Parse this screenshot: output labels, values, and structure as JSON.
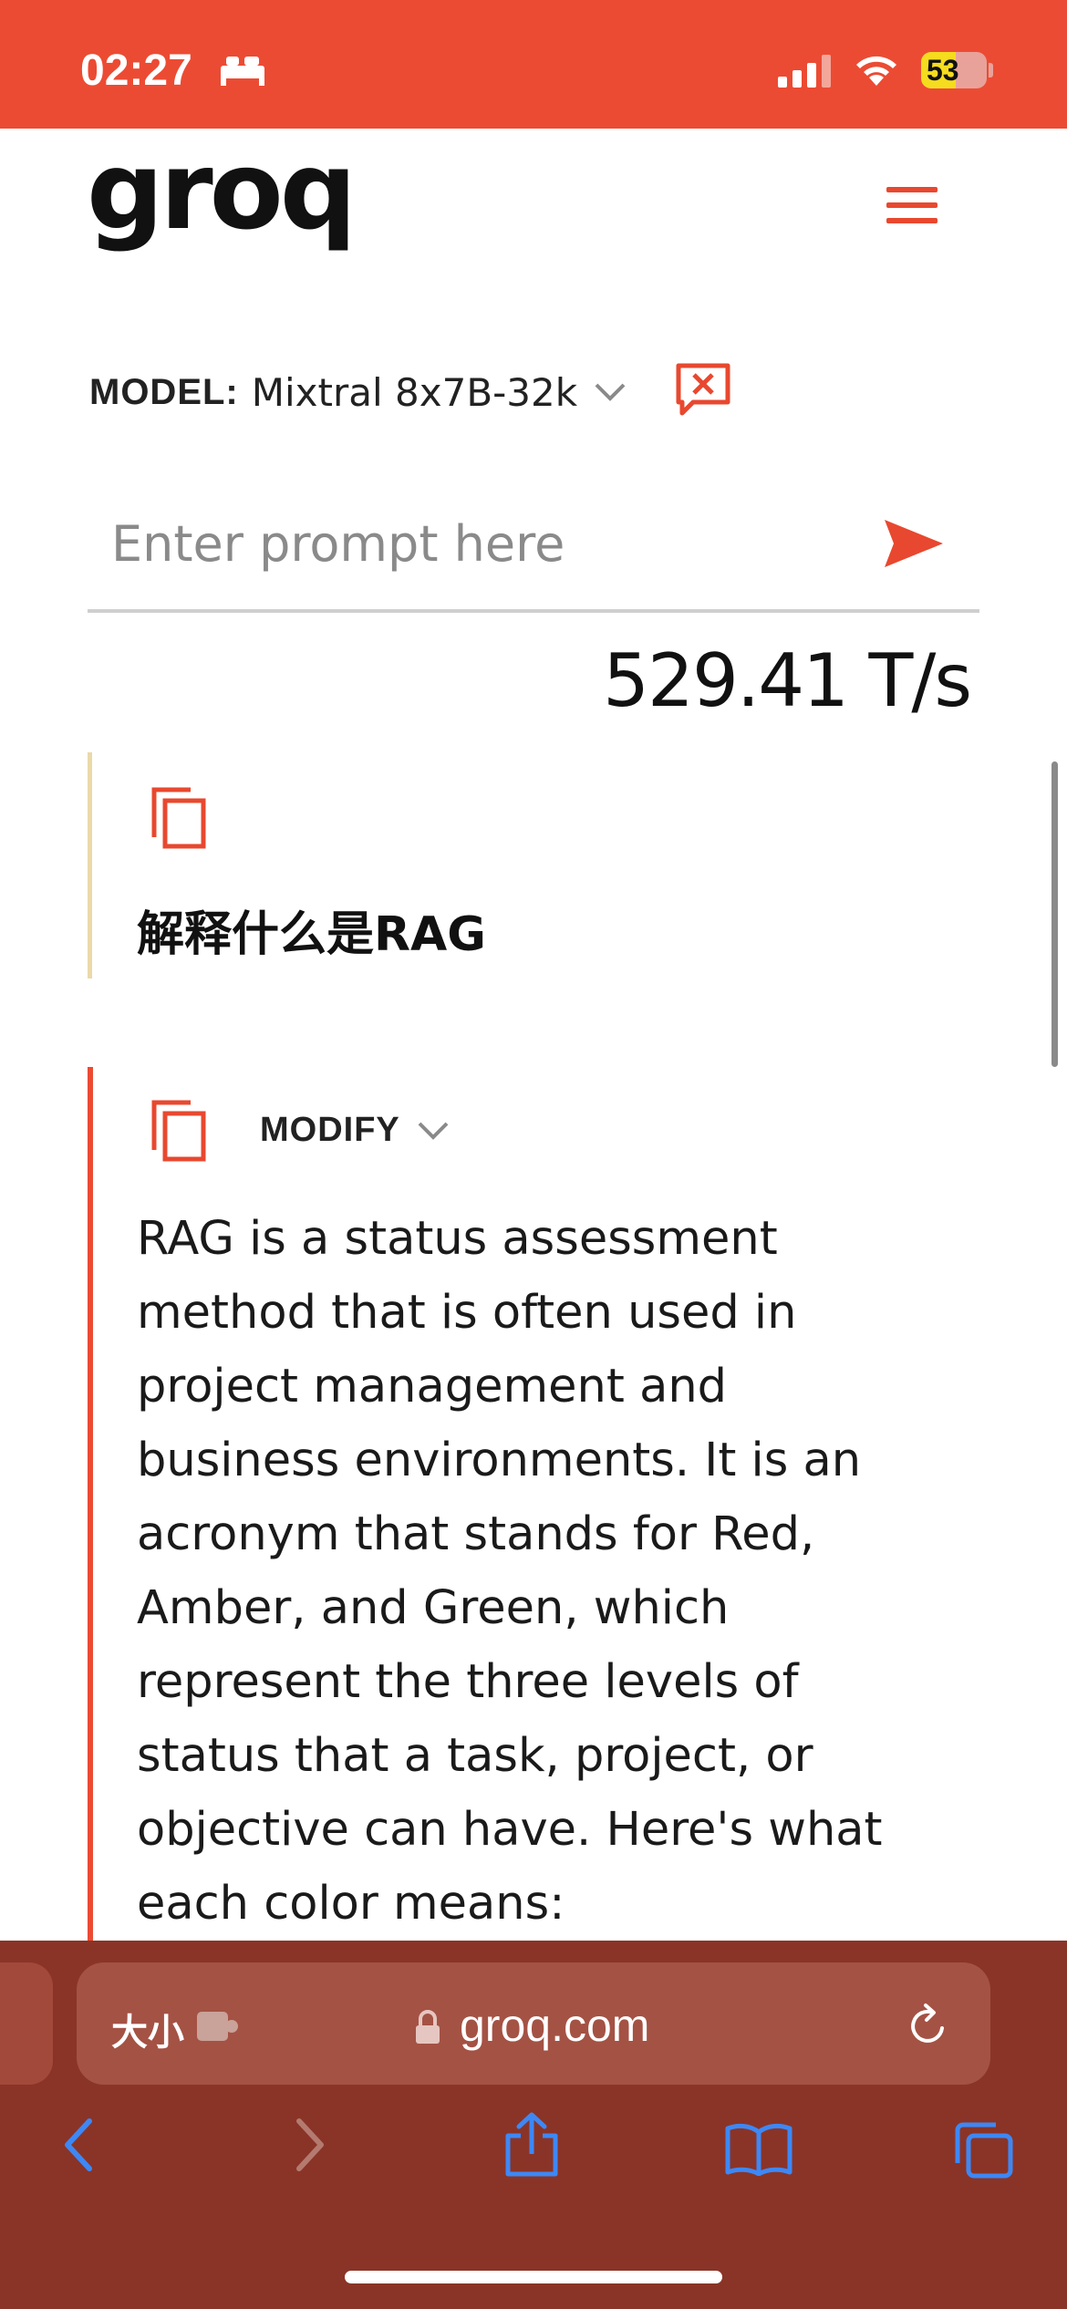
{
  "status_bar": {
    "time": "02:27",
    "battery_level": "53",
    "battery_fraction": 0.53,
    "colors": {
      "background": "#ec4b33"
    }
  },
  "header": {
    "logo": "groq",
    "menu_icon": "hamburger-icon"
  },
  "model_selector": {
    "label": "MODEL:",
    "value": "Mixtral 8x7B-32k"
  },
  "prompt": {
    "placeholder": "Enter prompt here"
  },
  "speed": "529.41 T/s",
  "messages": {
    "user": {
      "text": "解释什么是RAG",
      "accent": "#ead9a8"
    },
    "assistant": {
      "modify_label": "MODIFY",
      "accent": "#ec4b33",
      "text": "RAG is a status assessment\nmethod that is often used in\nproject management and\nbusiness environments. It is an\nacronym that stands for Red,\nAmber, and Green, which\nrepresent the three levels of\nstatus that a task, project, or\nobjective can have. Here's what\neach color means:"
    }
  },
  "browser": {
    "text_size_label": "大小",
    "url": "groq.com",
    "toolbar_icons": [
      "back-icon",
      "forward-icon",
      "share-icon",
      "bookmarks-icon",
      "tabs-icon"
    ],
    "colors": {
      "toolbar": "#8a3427",
      "url_field": "#a45244",
      "icons": "#3d88f5"
    }
  }
}
